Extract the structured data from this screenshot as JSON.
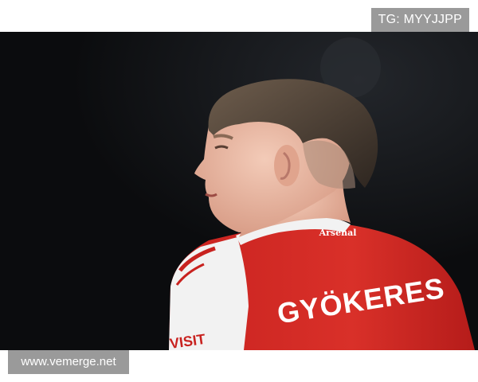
{
  "watermarks": {
    "top_right": "TG: MYYJJPP",
    "bottom_left": "www.vemerge.net"
  },
  "photo": {
    "jersey_badge": "Arsenal",
    "jersey_name": "GYÖKERES",
    "sleeve_text": "VISIT"
  },
  "colors": {
    "background": "#0b0c0e",
    "jersey_red": "#d42a26",
    "jersey_white": "#f2f2f2",
    "watermark_gray": "#9a9a9a"
  }
}
